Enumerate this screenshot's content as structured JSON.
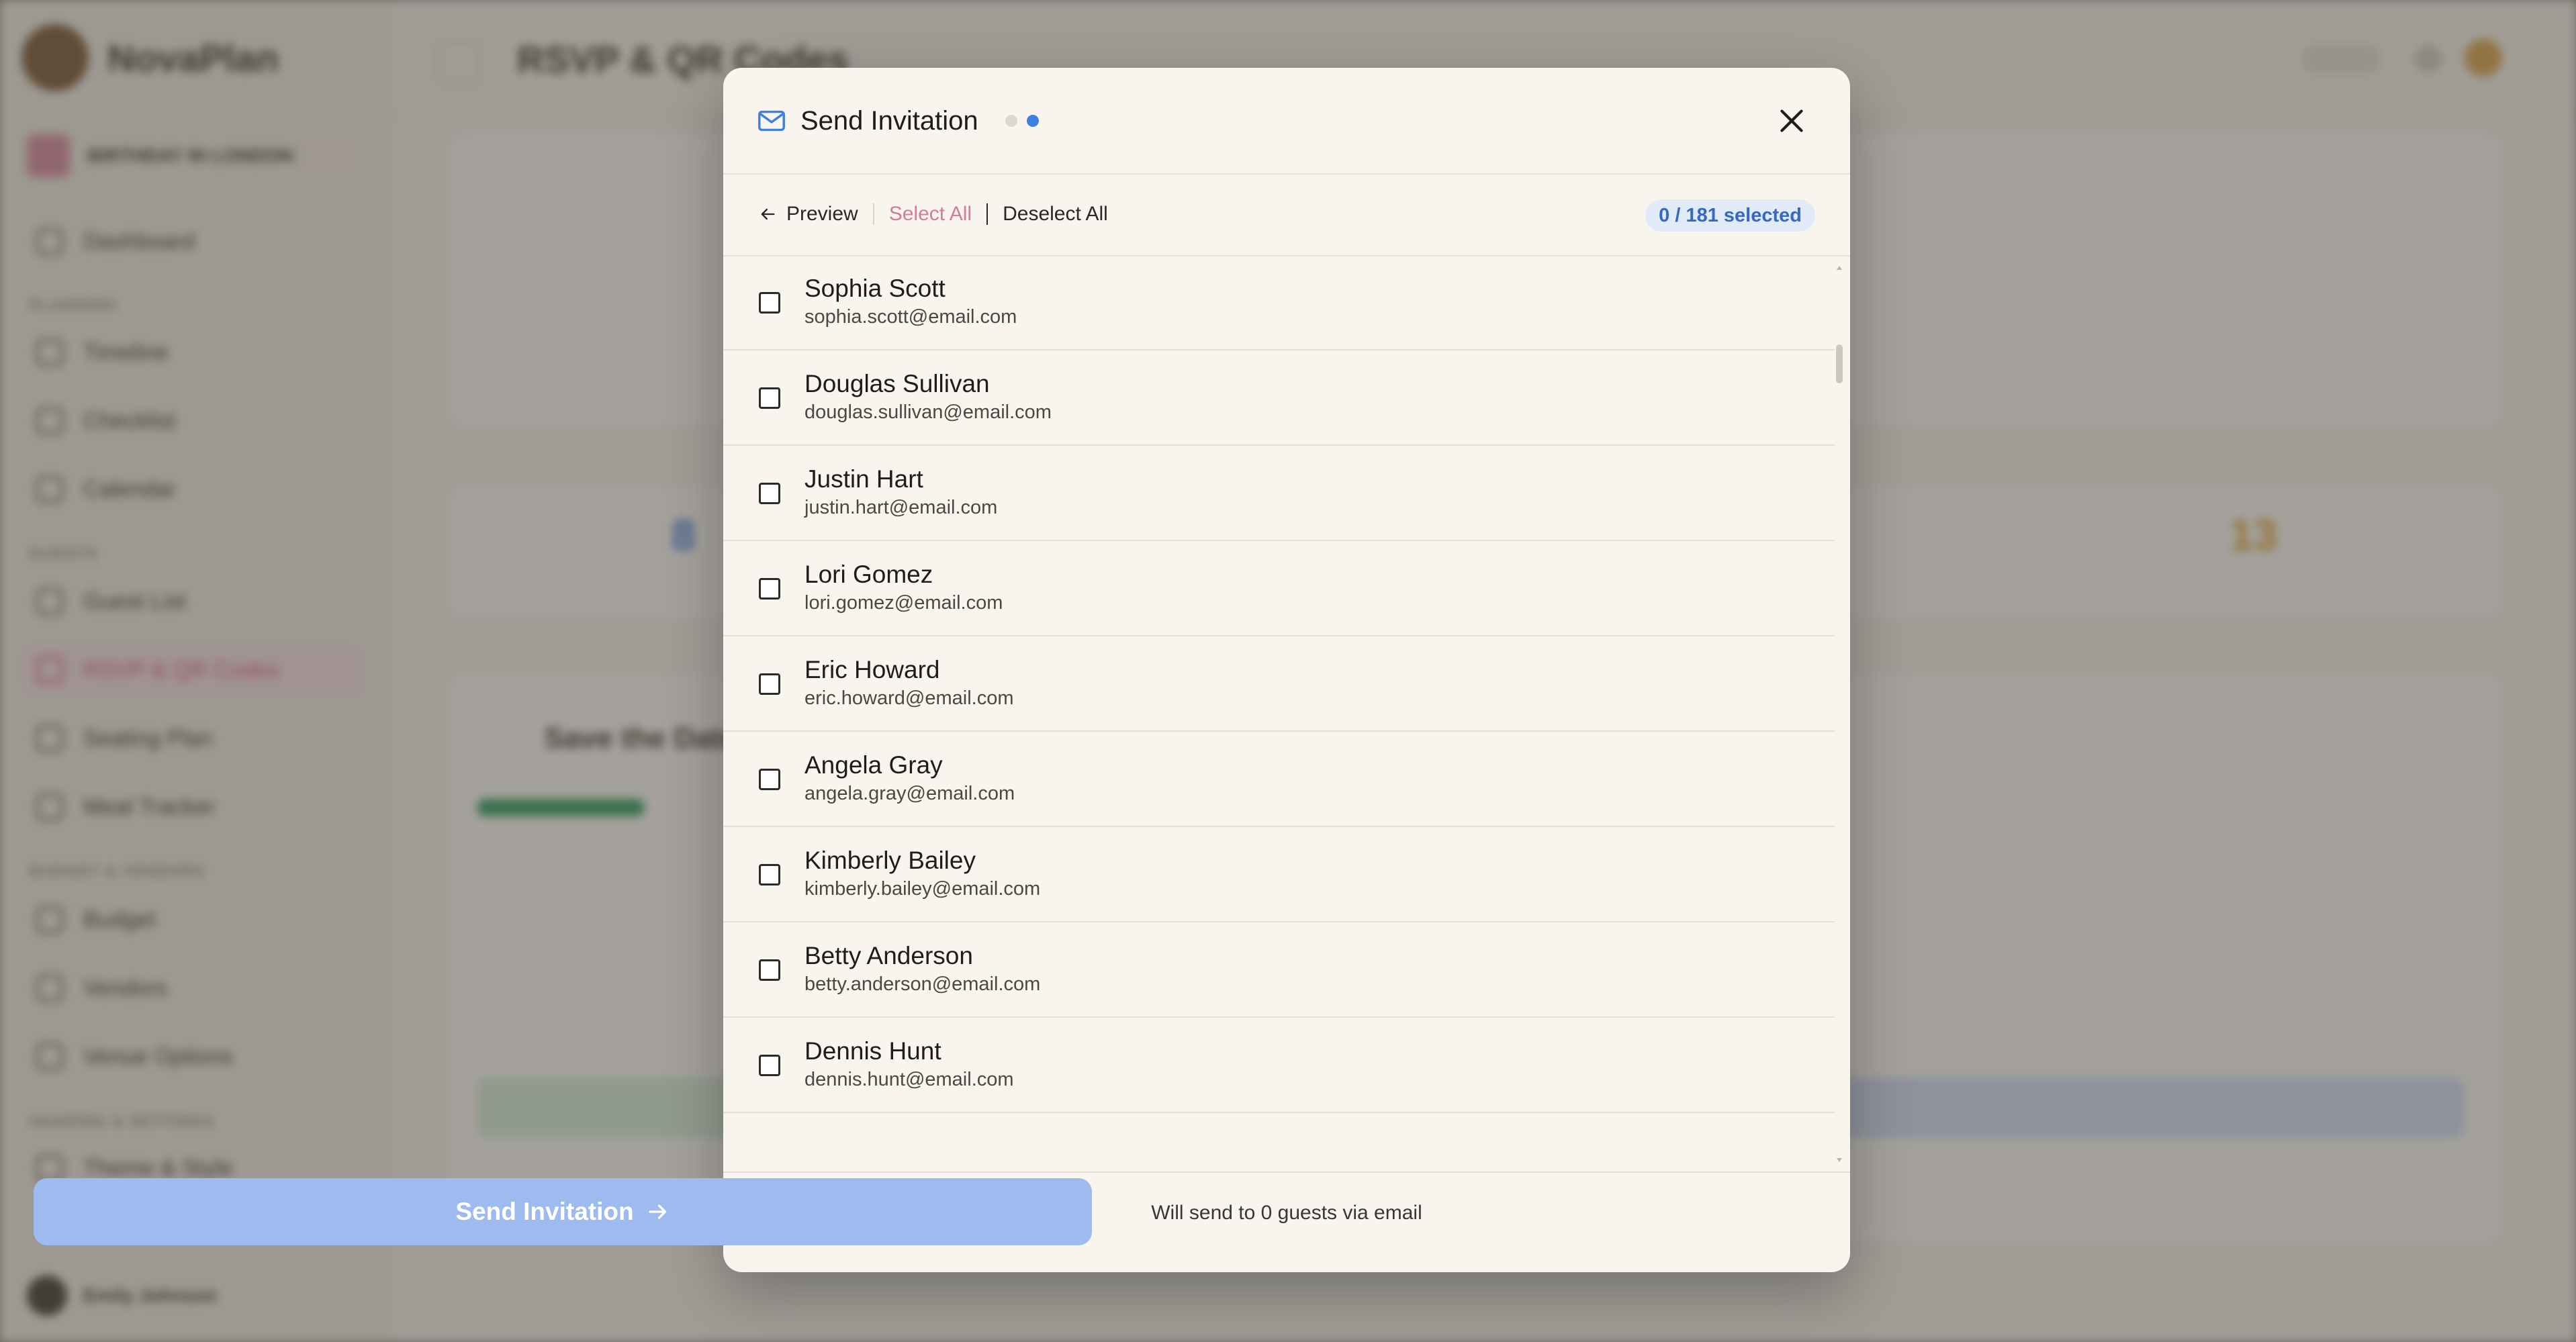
{
  "app": {
    "brand": "NovaPlan",
    "event": "BIRTHDAY IN LONDON",
    "page_title": "RSVP & QR Codes",
    "sidebar_sections": [
      "PLANNING",
      "GUESTS",
      "BUDGET & VENDORS",
      "SHARING & SETTINGS"
    ],
    "sidebar_items": [
      "Dashboard",
      "Timeline",
      "Checklist",
      "Calendar",
      "Guest List",
      "RSVP & QR Codes",
      "Seating Plan",
      "Meal Tracker",
      "Budget",
      "Vendors",
      "Venue Options",
      "Theme & Style"
    ],
    "user_name": "Emily Johnson",
    "section_title": "Save the Date"
  },
  "modal": {
    "title": "Send Invitation",
    "step_count": 2,
    "current_step": 2,
    "toolbar": {
      "preview_label": "Preview",
      "select_all_label": "Select All",
      "deselect_all_label": "Deselect All",
      "selected_count": "0 / 181 selected"
    },
    "guests": [
      {
        "name": "Sophia Scott",
        "email": "sophia.scott@email.com",
        "checked": false
      },
      {
        "name": "Douglas Sullivan",
        "email": "douglas.sullivan@email.com",
        "checked": false
      },
      {
        "name": "Justin Hart",
        "email": "justin.hart@email.com",
        "checked": false
      },
      {
        "name": "Lori Gomez",
        "email": "lori.gomez@email.com",
        "checked": false
      },
      {
        "name": "Eric Howard",
        "email": "eric.howard@email.com",
        "checked": false
      },
      {
        "name": "Angela Gray",
        "email": "angela.gray@email.com",
        "checked": false
      },
      {
        "name": "Kimberly Bailey",
        "email": "kimberly.bailey@email.com",
        "checked": false
      },
      {
        "name": "Betty Anderson",
        "email": "betty.anderson@email.com",
        "checked": false
      },
      {
        "name": "Dennis Hunt",
        "email": "dennis.hunt@email.com",
        "checked": false
      }
    ],
    "footer_note": "Will send to 0 guests via email",
    "send_label": "Send Invitation"
  },
  "colors": {
    "accent_blue": "#3f7fe0",
    "select_all_pink": "#d67b95",
    "send_button_disabled": "#9dbbee",
    "badge_bg": "#e1eaf7"
  },
  "icons": [
    "mail-icon",
    "close-icon",
    "arrow-left-icon",
    "arrow-right-icon",
    "checkbox-icon"
  ]
}
